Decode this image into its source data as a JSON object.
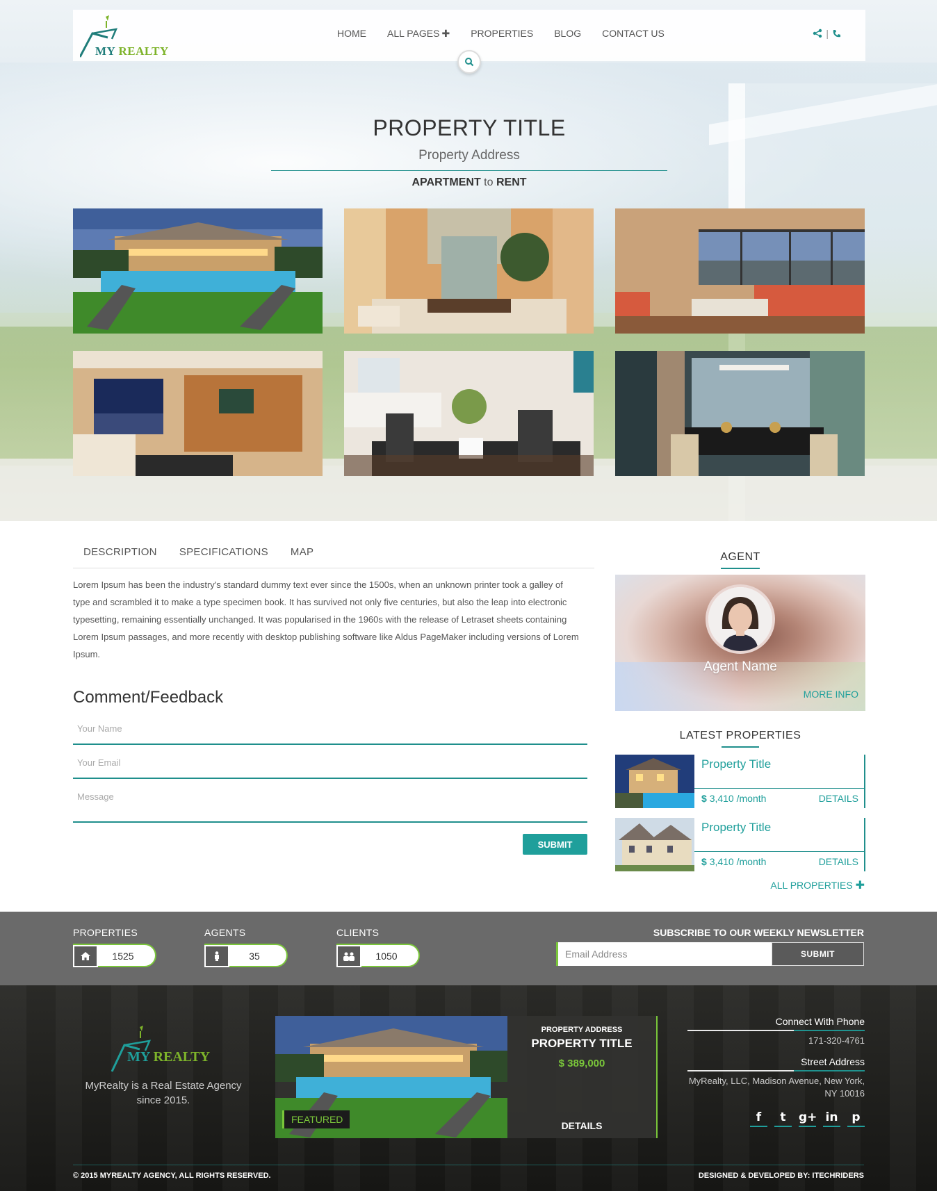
{
  "header": {
    "logo": "MY REALTY",
    "nav": [
      {
        "label": "HOME"
      },
      {
        "label": "ALL PAGES",
        "plus": "✚"
      },
      {
        "label": "PROPERTIES"
      },
      {
        "label": "BLOG"
      },
      {
        "label": "CONTACT US"
      }
    ],
    "share_icon": "share-icon",
    "phone_icon": "phone-icon",
    "separator": "|"
  },
  "hero": {
    "title": "PROPERTY TITLE",
    "address": "Property Address",
    "type_a": "APARTMENT",
    "type_to": "to",
    "type_b": "RENT"
  },
  "tabs": [
    "DESCRIPTION",
    "SPECIFICATIONS",
    "MAP"
  ],
  "description": "Lorem Ipsum has been the industry's standard dummy text ever since the 1500s, when an unknown printer took a galley of type and scrambled it to make a type specimen book. It has survived not only five centuries, but also the leap into electronic typesetting, remaining essentially unchanged. It was popularised in the 1960s with the release of Letraset sheets containing Lorem Ipsum passages, and more recently with desktop publishing software like Aldus PageMaker including versions of Lorem Ipsum.",
  "feedback": {
    "title": "Comment/Feedback",
    "name_placeholder": "Your Name",
    "email_placeholder": "Your Email",
    "message_placeholder": "Message",
    "submit": "SUBMIT"
  },
  "agent": {
    "heading": "AGENT",
    "name": "Agent Name",
    "more": "MORE INFO"
  },
  "latest": {
    "heading": "LATEST PROPERTIES",
    "items": [
      {
        "title": "Property Title",
        "currency": "$",
        "price": "3,410 /month",
        "details": "DETAILS"
      },
      {
        "title": "Property Title",
        "currency": "$",
        "price": "3,410 /month",
        "details": "DETAILS"
      }
    ],
    "all": "ALL PROPERTIES",
    "all_plus": "✚"
  },
  "stats": [
    {
      "label": "PROPERTIES",
      "value": "1525",
      "icon": "home-icon"
    },
    {
      "label": "AGENTS",
      "value": "35",
      "icon": "person-icon"
    },
    {
      "label": "CLIENTS",
      "value": "1050",
      "icon": "group-icon"
    }
  ],
  "newsletter": {
    "heading": "SUBSCRIBE TO OUR WEEKLY NEWSLETTER",
    "placeholder": "Email Address",
    "submit": "SUBMIT"
  },
  "footer": {
    "logo": "MY REALTY",
    "about": "MyRealty is a Real Estate Agency since 2015.",
    "featured": {
      "badge": "FEATURED",
      "address": "PROPERTY ADDRESS",
      "title": "PROPERTY TITLE",
      "price": "$ 389,000",
      "details": "DETAILS"
    },
    "phone_heading": "Connect With Phone",
    "phone": "171-320-4761",
    "street_heading": "Street Address",
    "street": "MyRealty, LLC, Madison Avenue, New York, NY 10016",
    "social": [
      "f",
      "t",
      "g+",
      "in",
      "p"
    ],
    "copyright": "© 2015 MYREALTY AGENCY, ALL RIGHTS RESERVED.",
    "developer": "DESIGNED & DEVELOPED BY: ITECHRIDERS"
  },
  "colors": {
    "accent": "#1f9f9b",
    "green": "#7ac63a"
  }
}
